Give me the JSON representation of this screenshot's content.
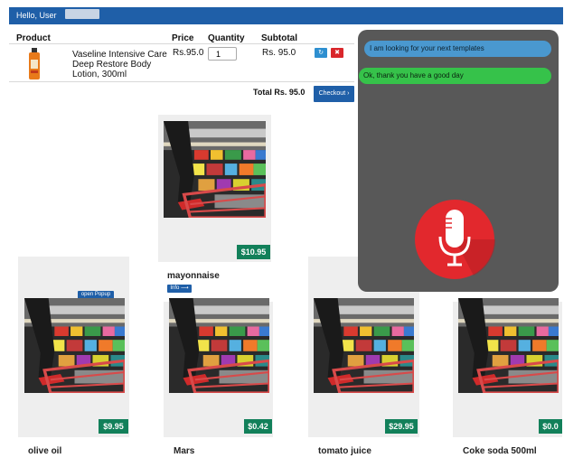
{
  "topbar": {
    "greeting": "Hello, User"
  },
  "cart": {
    "headers": {
      "product": "Product",
      "price": "Price",
      "quantity": "Quantity",
      "subtotal": "Subtotal"
    },
    "item": {
      "name": "Vaseline Intensive Care Deep Restore Body Lotion, 300ml",
      "price": "Rs.95.0",
      "quantity": "1",
      "subtotal": "Rs. 95.0"
    },
    "total": "Total Rs. 95.0",
    "checkout_label": "Checkout ›"
  },
  "products": {
    "featured": {
      "price": "$10.95",
      "name": "mayonnaise",
      "info_label": "Info ⟶"
    },
    "open_popup_label": "open Popup",
    "items": [
      {
        "name": "olive oil",
        "price": "$9.95"
      },
      {
        "name": "Mars",
        "price": "$0.42"
      },
      {
        "name": "tomato juice",
        "price": "$29.95"
      },
      {
        "name": "Coke soda 500ml",
        "price": "$0.0"
      }
    ]
  },
  "chat": {
    "messages": [
      {
        "from": "user",
        "text": "I am looking for your next templates"
      },
      {
        "from": "bot",
        "text": "Ok, thank you have a good day"
      }
    ]
  },
  "icons": {
    "refresh": "refresh-icon",
    "delete": "delete-icon",
    "mic": "microphone-icon"
  },
  "colors": {
    "brand": "#1f5fa8",
    "price_badge": "#12805a",
    "delete": "#d9262b",
    "refresh": "#2e8fd0",
    "chat_user": "#4a98cf",
    "chat_bot": "#36c24a",
    "mic": "#e2282d"
  }
}
